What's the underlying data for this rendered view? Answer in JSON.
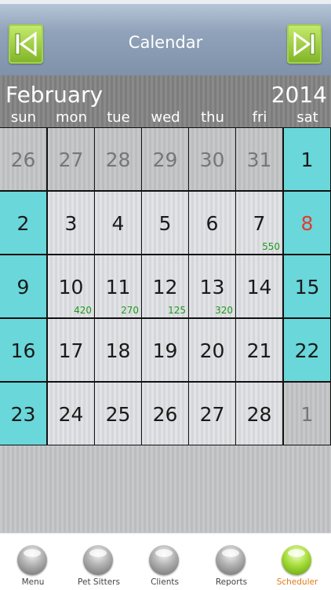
{
  "header": {
    "title": "Calendar",
    "prev_icon": "skip-previous-icon",
    "next_icon": "skip-next-icon",
    "accent": "#8cc63f"
  },
  "calendar": {
    "month": "February",
    "year": "2014",
    "weekdays": [
      "sun",
      "mon",
      "tue",
      "wed",
      "thu",
      "fri",
      "sat"
    ],
    "weekend_color": "#6ad7da",
    "weeks": [
      [
        {
          "day": "26",
          "other": true
        },
        {
          "day": "27",
          "other": true
        },
        {
          "day": "28",
          "other": true
        },
        {
          "day": "29",
          "other": true
        },
        {
          "day": "30",
          "other": true
        },
        {
          "day": "31",
          "other": true
        },
        {
          "day": "1",
          "weekend": true
        }
      ],
      [
        {
          "day": "2",
          "weekend": true
        },
        {
          "day": "3"
        },
        {
          "day": "4"
        },
        {
          "day": "5"
        },
        {
          "day": "6"
        },
        {
          "day": "7",
          "amount": "550"
        },
        {
          "day": "8",
          "weekend": true,
          "today": true
        }
      ],
      [
        {
          "day": "9",
          "weekend": true
        },
        {
          "day": "10",
          "amount": "420"
        },
        {
          "day": "11",
          "amount": "270"
        },
        {
          "day": "12",
          "amount": "125"
        },
        {
          "day": "13",
          "amount": "320"
        },
        {
          "day": "14"
        },
        {
          "day": "15",
          "weekend": true
        }
      ],
      [
        {
          "day": "16",
          "weekend": true
        },
        {
          "day": "17"
        },
        {
          "day": "18"
        },
        {
          "day": "19"
        },
        {
          "day": "20"
        },
        {
          "day": "21"
        },
        {
          "day": "22",
          "weekend": true
        }
      ],
      [
        {
          "day": "23",
          "weekend": true
        },
        {
          "day": "24"
        },
        {
          "day": "25"
        },
        {
          "day": "26"
        },
        {
          "day": "27"
        },
        {
          "day": "28"
        },
        {
          "day": "1",
          "other": true
        }
      ]
    ]
  },
  "tabs": [
    {
      "label": "Menu",
      "icon": "menu-ball-icon",
      "active": false
    },
    {
      "label": "Pet Sitters",
      "icon": "pet-sitters-ball-icon",
      "active": false
    },
    {
      "label": "Clients",
      "icon": "clients-ball-icon",
      "active": false
    },
    {
      "label": "Reports",
      "icon": "reports-ball-icon",
      "active": false
    },
    {
      "label": "Scheduler",
      "icon": "scheduler-ball-icon",
      "active": true
    }
  ]
}
